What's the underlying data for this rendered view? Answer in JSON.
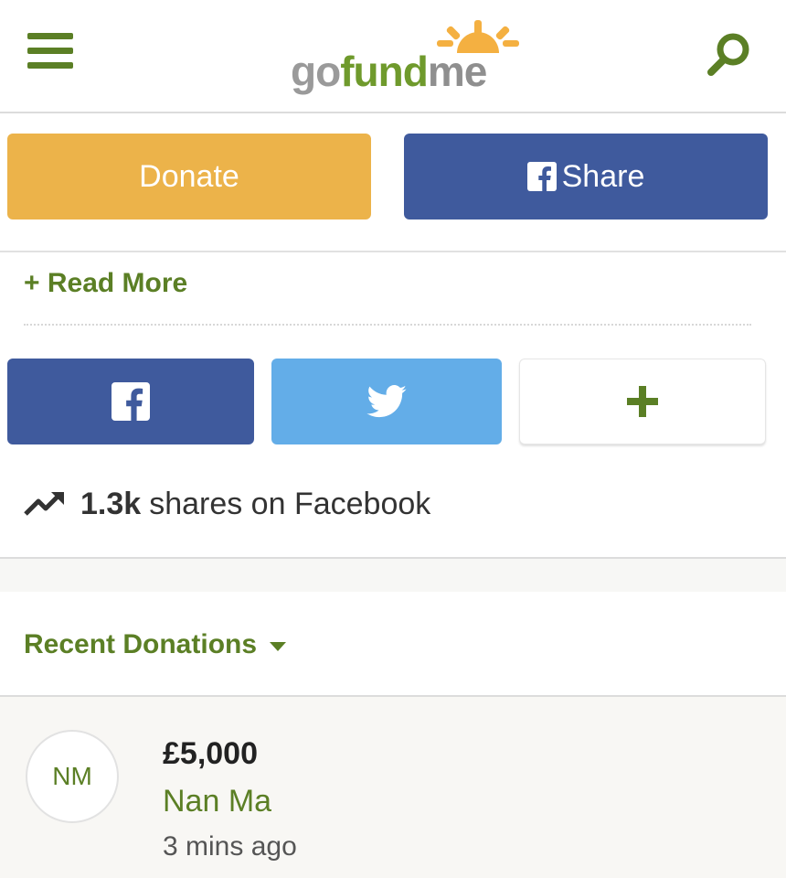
{
  "header": {
    "logo": {
      "go": "go",
      "fund": "fund",
      "me": "me"
    },
    "menu_icon": "hamburger-menu-icon",
    "search_icon": "search-icon"
  },
  "actions": {
    "donate_label": "Donate",
    "share_label": "Share"
  },
  "read_more_label": "+ Read More",
  "social": {
    "facebook_icon": "facebook-icon",
    "twitter_icon": "twitter-icon",
    "more_icon": "plus-icon"
  },
  "shares": {
    "count": "1.3k",
    "text": "shares on Facebook"
  },
  "recent_donations": {
    "title": "Recent Donations",
    "items": [
      {
        "initials": "NM",
        "amount": "£5,000",
        "name": "Nan Ma",
        "time": "3 mins ago"
      }
    ]
  },
  "colors": {
    "brand_green": "#5b7f25",
    "donate_yellow": "#ecb34a",
    "facebook_blue": "#3f5a9d",
    "twitter_blue": "#63ade8"
  }
}
